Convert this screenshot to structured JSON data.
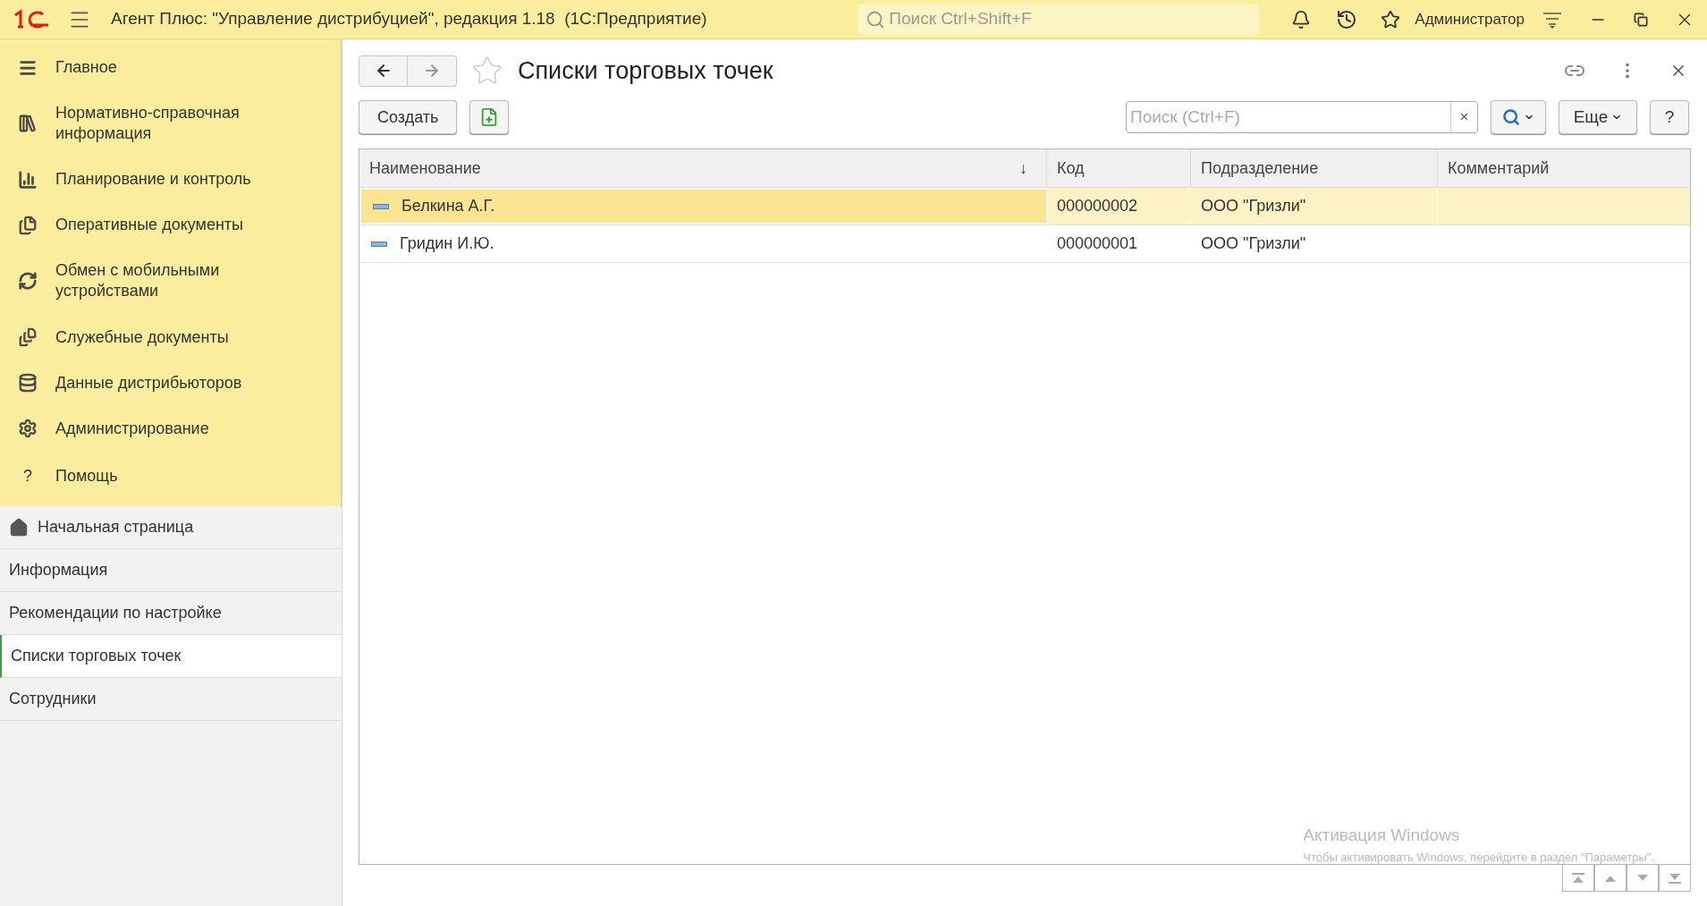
{
  "window": {
    "title": "Агент Плюс: \"Управление дистрибуцией\", редакция 1.18  (1С:Предприятие)",
    "search_placeholder": "Поиск Ctrl+Shift+F",
    "user": "Администратор"
  },
  "sections": [
    {
      "label": "Главное"
    },
    {
      "label": "Нормативно-справочная информация"
    },
    {
      "label": "Планирование и контроль"
    },
    {
      "label": "Оперативные документы"
    },
    {
      "label": "Обмен с мобильными устройствами"
    },
    {
      "label": "Служебные документы"
    },
    {
      "label": "Данные дистрибьюторов"
    },
    {
      "label": "Администрирование"
    },
    {
      "label": "Помощь",
      "glyph": "?"
    }
  ],
  "open_pages": [
    {
      "label": "Начальная страница",
      "kind": "home",
      "selected": false
    },
    {
      "label": "Информация",
      "kind": "page",
      "selected": false
    },
    {
      "label": "Рекомендации по настройке",
      "kind": "page",
      "selected": false
    },
    {
      "label": "Списки торговых точек",
      "kind": "page",
      "selected": true
    },
    {
      "label": "Сотрудники",
      "kind": "page",
      "selected": false
    }
  ],
  "form": {
    "title": "Списки торговых точек",
    "create_button": "Создать",
    "search_placeholder": "Поиск (Ctrl+F)",
    "clear": "×",
    "more_button": "Еще",
    "help_button": "?"
  },
  "table": {
    "columns": [
      {
        "label": "Наименование",
        "sort_mark": "↓"
      },
      {
        "label": "Код"
      },
      {
        "label": "Подразделение"
      },
      {
        "label": "Комментарий"
      }
    ],
    "rows": [
      {
        "selected": true,
        "cells": [
          "Белкина А.Г.",
          "000000002",
          "ООО \"Гризли\"",
          ""
        ]
      },
      {
        "selected": false,
        "cells": [
          "Гридин И.Ю.",
          "000000001",
          "ООО \"Гризли\"",
          ""
        ]
      }
    ]
  },
  "os_notice": {
    "title": "Активация Windows",
    "text": "Чтобы активировать Windows, перейдите в раздел \"Параметры\"."
  }
}
